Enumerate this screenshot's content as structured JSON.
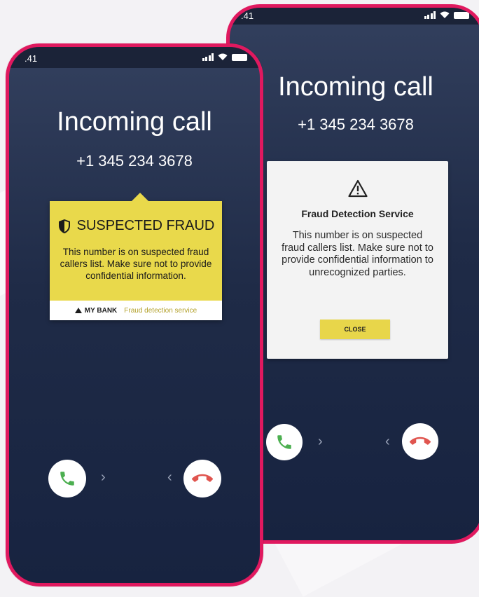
{
  "colors": {
    "accent_frame": "#e0195f",
    "screen_dark": "#1f2b47",
    "fraud_yellow": "#e9d94b",
    "accept_green": "#4caf50",
    "decline_red": "#e0554f"
  },
  "icons": [
    "signal-icon",
    "wifi-icon",
    "battery-icon",
    "shield-icon",
    "warning-icon",
    "phone-accept-icon",
    "phone-decline-icon",
    "bank-logo-icon"
  ],
  "front_phone": {
    "status": {
      "time": ".41"
    },
    "call": {
      "title": "Incoming call",
      "number": "+1 345 234 3678"
    },
    "fraud_card": {
      "heading": "SUSPECTED FRAUD",
      "body": "This number is on suspected fraud callers list. Make sure not to provide confidential information.",
      "bank_name": "MY BANK",
      "service_label": "Fraud detection service"
    },
    "controls": {
      "swipe_right": "›",
      "swipe_left": "‹"
    }
  },
  "back_phone": {
    "status": {
      "time": ".41"
    },
    "call": {
      "title": "Incoming call",
      "number": "+1 345 234 3678"
    },
    "dialog": {
      "title": "Fraud Detection Service",
      "body": "This number is on suspected fraud callers list. Make sure not to provide confidential information to unrecognized parties.",
      "close_label": "CLOSE"
    },
    "controls": {
      "swipe_right": "›",
      "swipe_left": "‹"
    }
  }
}
